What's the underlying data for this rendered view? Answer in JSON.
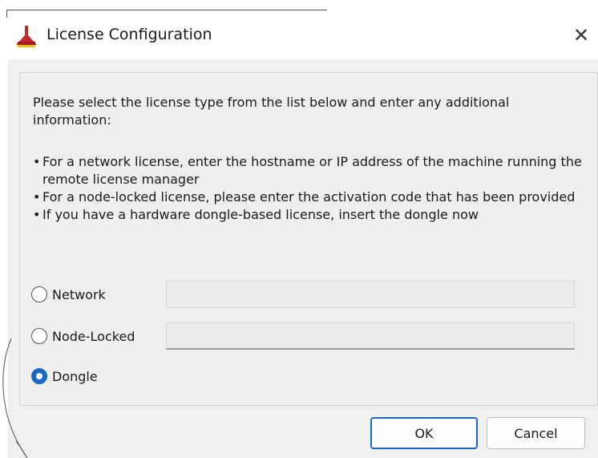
{
  "window": {
    "title": "License Configuration",
    "close_glyph": "✕",
    "icon": "license-app-icon"
  },
  "content": {
    "intro": "Please select the license type from the list below and enter any additional information:",
    "bullets": [
      "For a network license, enter the hostname or IP address of the machine running the remote license manager",
      "For a node-locked license, please enter the activation code that has been provided",
      "If you have a hardware dongle-based license, insert the dongle now"
    ]
  },
  "options": {
    "network": {
      "label": "Network",
      "selected": false,
      "value": ""
    },
    "node_locked": {
      "label": "Node-Locked",
      "selected": false,
      "value": ""
    },
    "dongle": {
      "label": "Dongle",
      "selected": true
    }
  },
  "buttons": {
    "ok": "OK",
    "cancel": "Cancel"
  },
  "colors": {
    "accent": "#1868c9",
    "icon_red": "#c0282d",
    "icon_yellow": "#e8c21a"
  }
}
